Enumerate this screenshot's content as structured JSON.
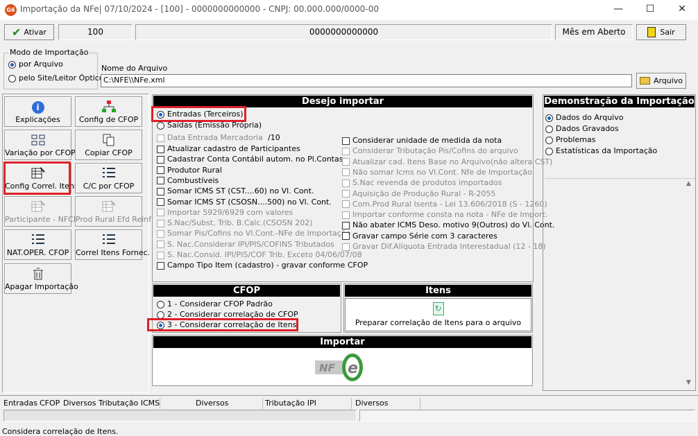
{
  "window": {
    "app_logo": "G6",
    "title": "Importação da NFe|  07/10/2024 - [100] - 0000000000000 - CNPJ: 00.000.000/0000-00",
    "minimize": "—",
    "maximize": "☐",
    "close": "✕"
  },
  "toolbar": {
    "ativar_label": "Ativar",
    "field1": "100",
    "field2": "0000000000000",
    "month_status": "Mês em Aberto",
    "sair_label": "Sair"
  },
  "import_mode": {
    "title": "Modo de Importação",
    "options": [
      "por Arquivo",
      "pelo Site/Leitor Óptico"
    ],
    "selected": 0
  },
  "file": {
    "label": "Nome do Arquivo",
    "value": "C:\\NFE\\\\NFe.xml",
    "button": "Arquivo"
  },
  "tools": [
    {
      "label": "Explicações",
      "icon": "info-icon",
      "enabled": true
    },
    {
      "label": "Config de CFOP",
      "icon": "flowchart-icon",
      "enabled": true
    },
    {
      "label": "Variação por CFOP",
      "icon": "grid-icon",
      "enabled": true
    },
    {
      "label": "Copiar CFOP",
      "icon": "copy-icon",
      "enabled": true
    },
    {
      "label": "Config Correl. Itens",
      "icon": "edit-table-icon",
      "enabled": true
    },
    {
      "label": "C/C por CFOP",
      "icon": "list-icon",
      "enabled": true
    },
    {
      "label": "Participante - NFCE",
      "icon": "edit-table-icon",
      "enabled": false
    },
    {
      "label": "Prod Rural Efd Reinf",
      "icon": "edit-table-icon",
      "enabled": false
    },
    {
      "label": "NAT.OPER. CFOP",
      "icon": "list-icon",
      "enabled": true
    },
    {
      "label": "Correl Itens Fornec.",
      "icon": "list-icon",
      "enabled": true
    },
    {
      "label": "Apagar Importação",
      "icon": "trash-icon",
      "enabled": true
    }
  ],
  "desejo": {
    "title": "Desejo importar",
    "radios": [
      "Entradas (Terceiros)",
      "Saídas (Emissão Própria)"
    ],
    "selected": 0,
    "date_label": "Data Entrada Mercadoria",
    "date_value": "/10",
    "left_checks": [
      {
        "label": "Atualizar cadastro de Participantes",
        "enabled": true
      },
      {
        "label": "Cadastrar Conta Contábil autom. no Pl.Contas",
        "enabled": true
      },
      {
        "label": "Produtor Rural",
        "enabled": true
      },
      {
        "label": "Combustíveis",
        "enabled": true
      },
      {
        "label": "Somar ICMS ST (CST....60) no Vl. Cont.",
        "enabled": true
      },
      {
        "label": "Somar ICMS ST (CSOSN....500) no Vl. Cont.",
        "enabled": true
      },
      {
        "label": "Importar 5929/6929 com valores",
        "enabled": false
      },
      {
        "label": "S.Nac/Subst. Trib. B.Calc.(CSOSN 202)",
        "enabled": false
      },
      {
        "label": "Somar Pis/Cofins no Vl.Cont.-NFe de Importação",
        "enabled": false
      },
      {
        "label": "S. Nac.Considerar IPI/PIS/COFINS Tributados",
        "enabled": false
      },
      {
        "label": "S. Nac.Consid. IPI/PIS/COF Trib. Exceto 04/06/07/08",
        "enabled": false
      },
      {
        "label": "Campo Tipo Item (cadastro) - gravar conforme CFOP",
        "enabled": true
      }
    ],
    "right_checks": [
      {
        "label": "Considerar unidade de medida da nota",
        "enabled": true
      },
      {
        "label": "Considerar Tributação Pis/Cofins do arquivo",
        "enabled": false
      },
      {
        "label": "Atualizar cad. Itens Base no Arquivo(não altera CST)",
        "enabled": false
      },
      {
        "label": "Não somar Icms no Vl.Cont. Nfe de Importação",
        "enabled": false
      },
      {
        "label": "S.Nac revenda de produtos importados",
        "enabled": false
      },
      {
        "label": "Aquisição de Produção Rural - R-2055",
        "enabled": false
      },
      {
        "label": "Com.Prod Rural Isenta - Lei 13.606/2018 (S - 1260)",
        "enabled": false
      },
      {
        "label": "Importar conforme consta na nota - NFe de Import.",
        "enabled": false
      },
      {
        "label": "Não abater ICMS Deso. motivo 9(Outros) do Vl. Cont.",
        "enabled": true
      },
      {
        "label": "Gravar campo Série com 3 caracteres",
        "enabled": true
      },
      {
        "label": "Gravar Dif.Alíquota Entrada Interestadual (12 - 18)",
        "enabled": false
      }
    ]
  },
  "cfop": {
    "title": "CFOP",
    "options": [
      "1 - Considerar CFOP Padrão",
      "2 - Considerar correlação de CFOP",
      "3 - Considerar correlação de Itens"
    ],
    "selected": 2
  },
  "itens": {
    "title": "Itens",
    "button": "Preparar correlação de Itens para o arquivo"
  },
  "importar": {
    "title": "Importar",
    "logo_text": "NF"
  },
  "demo": {
    "title": "Demonstração da Importação",
    "options": [
      "Dados do Arquivo",
      "Dados Gravados",
      "Problemas",
      "Estatísticas da Importação"
    ],
    "selected": 0,
    "scroll_up": "▲",
    "scroll_down": "▼"
  },
  "summary": {
    "labels": [
      "Entradas",
      "CFOP",
      "Diversos",
      "Tributação ICMS",
      "Diversos",
      "Tributação IPI",
      "Diversos"
    ]
  },
  "status_message": "Considera correlação de Itens."
}
